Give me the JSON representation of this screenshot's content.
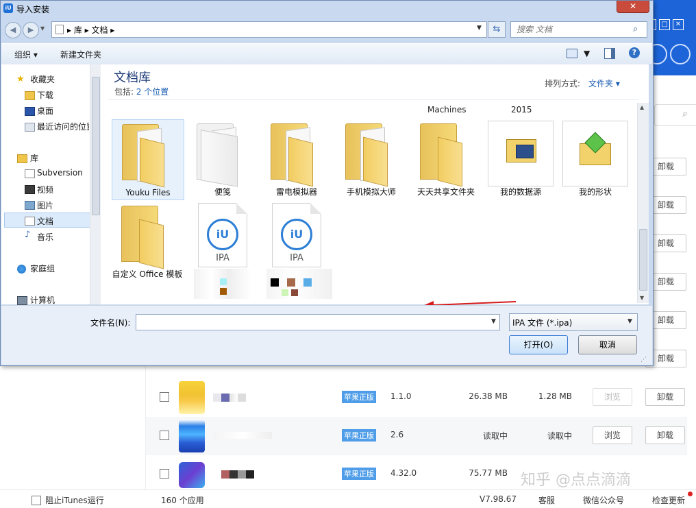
{
  "dialog": {
    "title": "导入安装",
    "close": "✕",
    "address": {
      "crumbs": "▸  库  ▸  文档  ▸"
    },
    "search_placeholder": "搜索 文档",
    "toolbar": {
      "organize": "组织 ▾",
      "new_folder": "新建文件夹"
    },
    "nav": {
      "favorites": "收藏夹",
      "downloads": "下载",
      "desktop": "桌面",
      "recent": "最近访问的位置",
      "libraries": "库",
      "subversion": "Subversion",
      "videos": "视频",
      "pictures": "图片",
      "documents": "文档",
      "music": "音乐",
      "homegroup": "家庭组",
      "computer": "计算机"
    },
    "library": {
      "title": "文档库",
      "includes_prefix": "包括: ",
      "includes_link": "2 个位置",
      "arrange_label": "排列方式:",
      "arrange_value": "文件夹 ▾"
    },
    "top_labels": {
      "machines": "Machines",
      "year": "2015"
    },
    "items": {
      "youku": "Youku Files",
      "bianjian": "便笺",
      "leidian": "雷电模拟器",
      "shouji": "手机模拟大师",
      "tiantian": "天天共享文件夹",
      "datasource": "我的数据源",
      "shapes": "我的形状",
      "office": "自定义 Office 模板",
      "ipa_label": "IPA",
      "ipa_logo": "iU"
    },
    "filename_label": "文件名(N):",
    "filename_value": "",
    "filetype": "IPA 文件 (*.ipa)",
    "open": "打开(O)",
    "cancel": "取消"
  },
  "app": {
    "rows": [
      {
        "badge": "苹果正版",
        "version": "1.1.0",
        "size": "26.38 MB",
        "data": "1.28 MB",
        "browse": "浏览",
        "uninstall": "卸载"
      },
      {
        "badge": "苹果正版",
        "version": "2.6",
        "size": "读取中",
        "data": "读取中",
        "browse": "浏览",
        "uninstall": "卸载"
      },
      {
        "badge": "苹果正版",
        "version": "4.32.0",
        "size": "75.77 MB",
        "data": "",
        "browse": "",
        "uninstall": ""
      }
    ],
    "uninstall_label": "卸载",
    "footer": {
      "block_itunes": "阻止iTunes运行",
      "app_count": "160 个应用",
      "version": "V7.98.67",
      "support": "客服",
      "wechat": "微信公众号",
      "update": "检查更新"
    },
    "watermark": "知乎 @点点滴滴"
  }
}
